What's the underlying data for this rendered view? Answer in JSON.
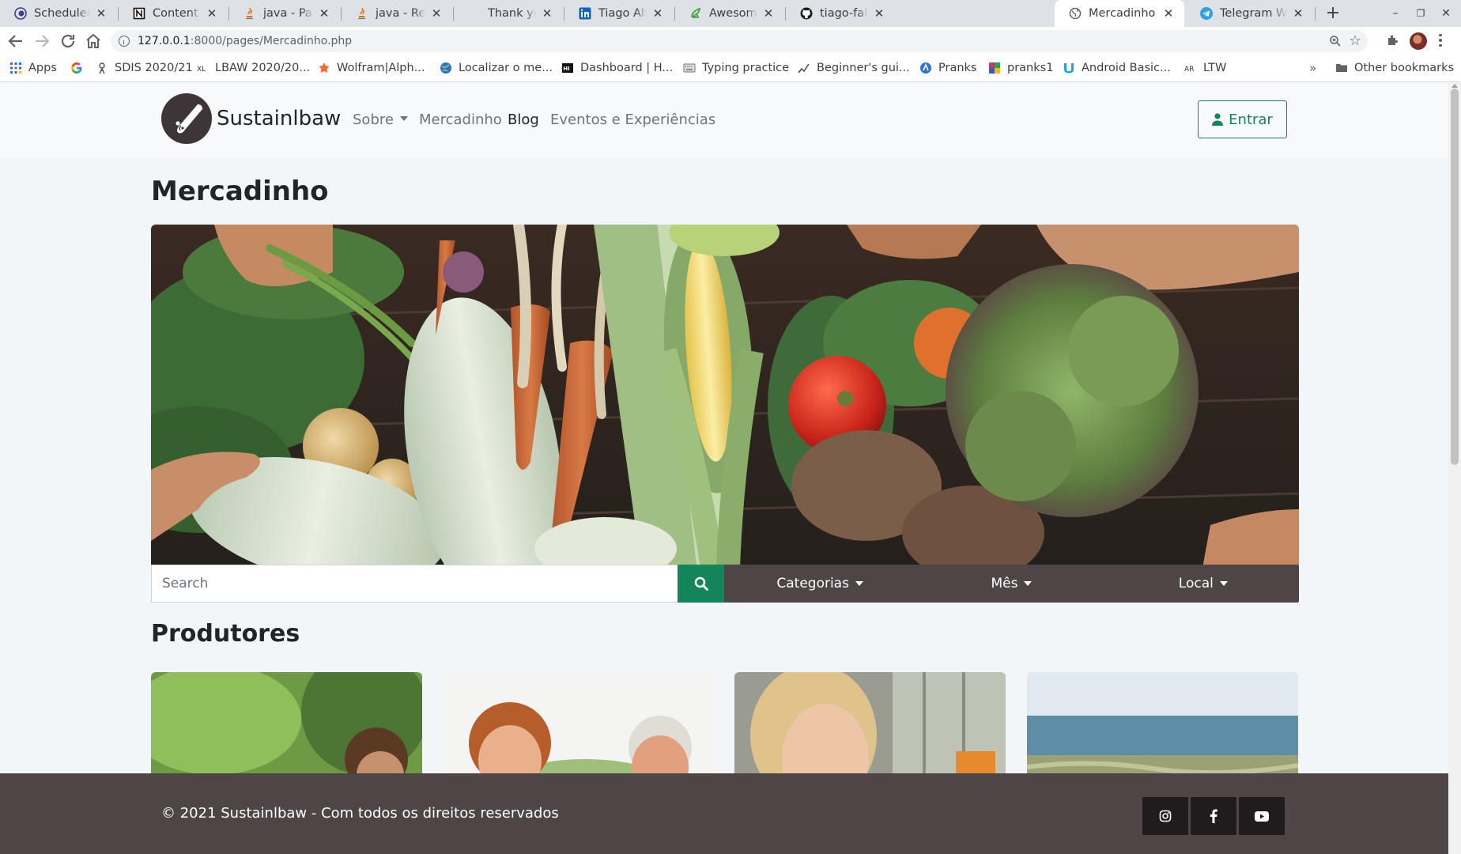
{
  "browser": {
    "tabs": [
      {
        "title": "ScheduledThre",
        "icon": "eclipse-icon"
      },
      {
        "title": "Content roots -",
        "icon": "notion-icon"
      },
      {
        "title": "java - Package e",
        "icon": "java-icon"
      },
      {
        "title": "java - Registeri",
        "icon": "java-icon"
      },
      {
        "title": "Thank you for c",
        "icon": "blank-icon"
      },
      {
        "title": "Tiago Alves | Li",
        "icon": "linkedin-icon"
      },
      {
        "title": "Awesome CV C",
        "icon": "overleaf-icon"
      },
      {
        "title": "tiago-falves (Ti",
        "icon": "github-icon"
      },
      {
        "title": "Mercadinho",
        "icon": "globe-icon",
        "active": true
      },
      {
        "title": "Telegram Web",
        "icon": "telegram-icon"
      }
    ],
    "url_host": "127.0.0.1",
    "url_path": ":8000/pages/Mercadinho.php",
    "bookmarks": [
      {
        "label": "Apps",
        "icon": "apps-grid-icon"
      },
      {
        "label": "",
        "icon": "google-icon"
      },
      {
        "label": "SDIS 2020/21",
        "icon": "person-icon"
      },
      {
        "label": "LBAW 2020/20...",
        "icon": "lbaw-icon"
      },
      {
        "label": "Wolfram|Alph...",
        "icon": "wolfram-icon"
      },
      {
        "label": "Localizar o me...",
        "icon": "globe-icon"
      },
      {
        "label": "Dashboard | H...",
        "icon": "dashboard-icon"
      },
      {
        "label": "Typing practice",
        "icon": "keyboard-icon"
      },
      {
        "label": "Beginner's gui...",
        "icon": "chart-icon"
      },
      {
        "label": "Pranks",
        "icon": "pranks-icon"
      },
      {
        "label": "pranks1",
        "icon": "pranks1-icon"
      },
      {
        "label": "Android Basic...",
        "icon": "udacity-icon"
      },
      {
        "label": "LTW",
        "icon": "ar-icon"
      }
    ],
    "bookmarks_overflow": "»",
    "other_bookmarks": "Other bookmarks",
    "new_tab_symbol": "+",
    "window_controls": [
      "–",
      "❐",
      "✕"
    ]
  },
  "site": {
    "brand": "Sustainlbaw",
    "nav": [
      {
        "label": "Sobre",
        "dropdown": true
      },
      {
        "label": "Mercadinho"
      },
      {
        "label": "Blog",
        "active": true
      },
      {
        "label": "Eventos e Experiências"
      }
    ],
    "login_label": "Entrar",
    "accent_color": "#14845b",
    "dark_color": "#4e4547"
  },
  "main": {
    "title": "Mercadinho",
    "search_placeholder": "Search",
    "filters": [
      {
        "label": "Categorias"
      },
      {
        "label": "Mês"
      },
      {
        "label": "Local"
      }
    ],
    "producers_title": "Produtores"
  },
  "footer": {
    "copyright": "© 2021 Sustainlbaw - Com todos os direitos reservados",
    "social": [
      "instagram-icon",
      "facebook-icon",
      "youtube-icon"
    ]
  }
}
